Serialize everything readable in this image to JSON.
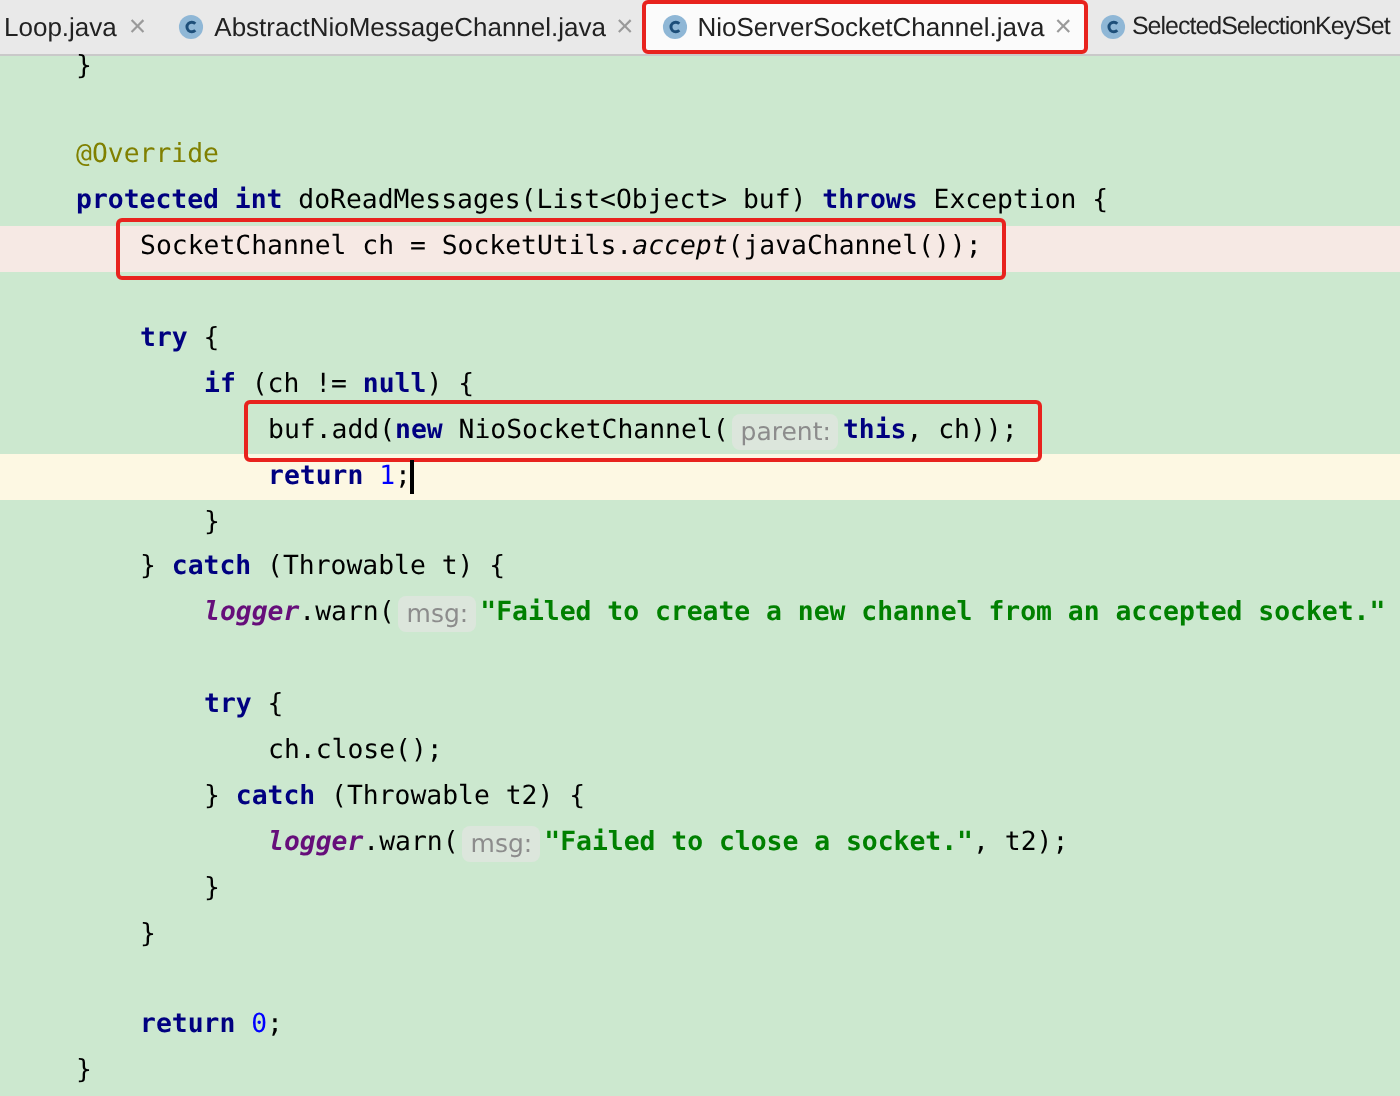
{
  "tabs": [
    {
      "label": "Loop.java",
      "icon": false,
      "closable": true,
      "selected": false,
      "boxed": false
    },
    {
      "label": "AbstractNioMessageChannel.java",
      "icon": true,
      "closable": true,
      "selected": false,
      "boxed": false
    },
    {
      "label": "NioServerSocketChannel.java",
      "icon": true,
      "closable": true,
      "selected": true,
      "boxed": true
    },
    {
      "label": "SelectedSelectionKeySet",
      "icon": true,
      "closable": false,
      "selected": false,
      "boxed": false
    }
  ],
  "close_glyph": "×",
  "editor": {
    "lines": [
      {
        "kind": "code",
        "error": false,
        "current": false,
        "boxed": false,
        "caret": false,
        "tokens": [
          {
            "kind": "plain",
            "text": "}"
          }
        ]
      },
      {
        "kind": "blank",
        "error": false,
        "current": false,
        "boxed": false,
        "caret": false
      },
      {
        "kind": "code",
        "error": false,
        "current": false,
        "boxed": false,
        "caret": false,
        "tokens": [
          {
            "kind": "annotation",
            "text": "@Override"
          }
        ]
      },
      {
        "kind": "code",
        "error": false,
        "current": false,
        "boxed": false,
        "caret": false,
        "tokens": [
          {
            "kind": "keyword",
            "text": "protected int"
          },
          {
            "kind": "plain",
            "text": " doReadMessages(List<Object> buf) "
          },
          {
            "kind": "keyword",
            "text": "throws"
          },
          {
            "kind": "plain",
            "text": " Exception {"
          }
        ],
        "children": [
          {
            "kind": "code",
            "error": true,
            "current": false,
            "boxed": true,
            "caret": false,
            "tokens": [
              {
                "kind": "plain",
                "text": "SocketChannel ch = SocketUtils."
              },
              {
                "kind": "italic",
                "text": "accept"
              },
              {
                "kind": "plain",
                "text": "(javaChannel());"
              }
            ]
          },
          {
            "kind": "blank",
            "error": false,
            "current": false,
            "boxed": false,
            "caret": false
          },
          {
            "kind": "code",
            "error": false,
            "current": false,
            "boxed": false,
            "caret": false,
            "tokens": [
              {
                "kind": "keyword",
                "text": "try"
              },
              {
                "kind": "plain",
                "text": " {"
              }
            ],
            "children": [
              {
                "kind": "code",
                "error": false,
                "current": false,
                "boxed": false,
                "caret": false,
                "tokens": [
                  {
                    "kind": "keyword",
                    "text": "if"
                  },
                  {
                    "kind": "plain",
                    "text": " (ch != "
                  },
                  {
                    "kind": "keyword",
                    "text": "null"
                  },
                  {
                    "kind": "plain",
                    "text": ") {"
                  }
                ],
                "children": [
                  {
                    "kind": "code",
                    "error": false,
                    "current": false,
                    "boxed": true,
                    "caret": false,
                    "tokens": [
                      {
                        "kind": "plain",
                        "text": "buf.add("
                      },
                      {
                        "kind": "keyword",
                        "text": "new"
                      },
                      {
                        "kind": "plain",
                        "text": " NioSocketChannel("
                      },
                      {
                        "kind": "hint",
                        "text": "parent:"
                      },
                      {
                        "kind": "keyword",
                        "text": "this"
                      },
                      {
                        "kind": "plain",
                        "text": ", ch));"
                      }
                    ]
                  },
                  {
                    "kind": "code",
                    "error": false,
                    "current": true,
                    "boxed": false,
                    "caret": true,
                    "tokens": [
                      {
                        "kind": "keyword",
                        "text": "return "
                      },
                      {
                        "kind": "number",
                        "text": "1"
                      },
                      {
                        "kind": "plain",
                        "text": ";"
                      }
                    ]
                  }
                ]
              },
              {
                "kind": "code",
                "error": false,
                "current": false,
                "boxed": false,
                "caret": false,
                "tokens": [
                  {
                    "kind": "plain",
                    "text": "}"
                  }
                ]
              }
            ]
          },
          {
            "kind": "code",
            "error": false,
            "current": false,
            "boxed": false,
            "caret": false,
            "tokens": [
              {
                "kind": "plain",
                "text": "} "
              },
              {
                "kind": "keyword",
                "text": "catch"
              },
              {
                "kind": "plain",
                "text": " (Throwable t) {"
              }
            ],
            "children": [
              {
                "kind": "code",
                "error": false,
                "current": false,
                "boxed": false,
                "caret": false,
                "tokens": [
                  {
                    "kind": "static",
                    "text": "logger"
                  },
                  {
                    "kind": "plain",
                    "text": ".warn("
                  },
                  {
                    "kind": "hint",
                    "text": "msg:"
                  },
                  {
                    "kind": "string",
                    "text": "\"Failed to create a new channel from an accepted socket.\""
                  }
                ]
              },
              {
                "kind": "blank",
                "error": false,
                "current": false,
                "boxed": false,
                "caret": false
              },
              {
                "kind": "code",
                "error": false,
                "current": false,
                "boxed": false,
                "caret": false,
                "tokens": [
                  {
                    "kind": "keyword",
                    "text": "try"
                  },
                  {
                    "kind": "plain",
                    "text": " {"
                  }
                ],
                "children": [
                  {
                    "kind": "code",
                    "error": false,
                    "current": false,
                    "boxed": false,
                    "caret": false,
                    "tokens": [
                      {
                        "kind": "plain",
                        "text": "ch.close();"
                      }
                    ]
                  }
                ]
              },
              {
                "kind": "code",
                "error": false,
                "current": false,
                "boxed": false,
                "caret": false,
                "tokens": [
                  {
                    "kind": "plain",
                    "text": "} "
                  },
                  {
                    "kind": "keyword",
                    "text": "catch"
                  },
                  {
                    "kind": "plain",
                    "text": " (Throwable t2) {"
                  }
                ],
                "children": [
                  {
                    "kind": "code",
                    "error": false,
                    "current": false,
                    "boxed": false,
                    "caret": false,
                    "tokens": [
                      {
                        "kind": "static",
                        "text": "logger"
                      },
                      {
                        "kind": "plain",
                        "text": ".warn("
                      },
                      {
                        "kind": "hint",
                        "text": "msg:"
                      },
                      {
                        "kind": "string",
                        "text": "\"Failed to close a socket.\""
                      },
                      {
                        "kind": "plain",
                        "text": ", t2);"
                      }
                    ]
                  }
                ]
              },
              {
                "kind": "code",
                "error": false,
                "current": false,
                "boxed": false,
                "caret": false,
                "tokens": [
                  {
                    "kind": "plain",
                    "text": "}"
                  }
                ]
              }
            ]
          },
          {
            "kind": "code",
            "error": false,
            "current": false,
            "boxed": false,
            "caret": false,
            "tokens": [
              {
                "kind": "plain",
                "text": "}"
              }
            ]
          },
          {
            "kind": "blank",
            "error": false,
            "current": false,
            "boxed": false,
            "caret": false
          },
          {
            "kind": "code",
            "error": false,
            "current": false,
            "boxed": false,
            "caret": false,
            "tokens": [
              {
                "kind": "keyword",
                "text": "return "
              },
              {
                "kind": "number",
                "text": "0"
              },
              {
                "kind": "plain",
                "text": ";"
              }
            ]
          }
        ]
      },
      {
        "kind": "code",
        "error": false,
        "current": false,
        "boxed": false,
        "caret": false,
        "tokens": [
          {
            "kind": "plain",
            "text": "}"
          }
        ]
      }
    ]
  }
}
